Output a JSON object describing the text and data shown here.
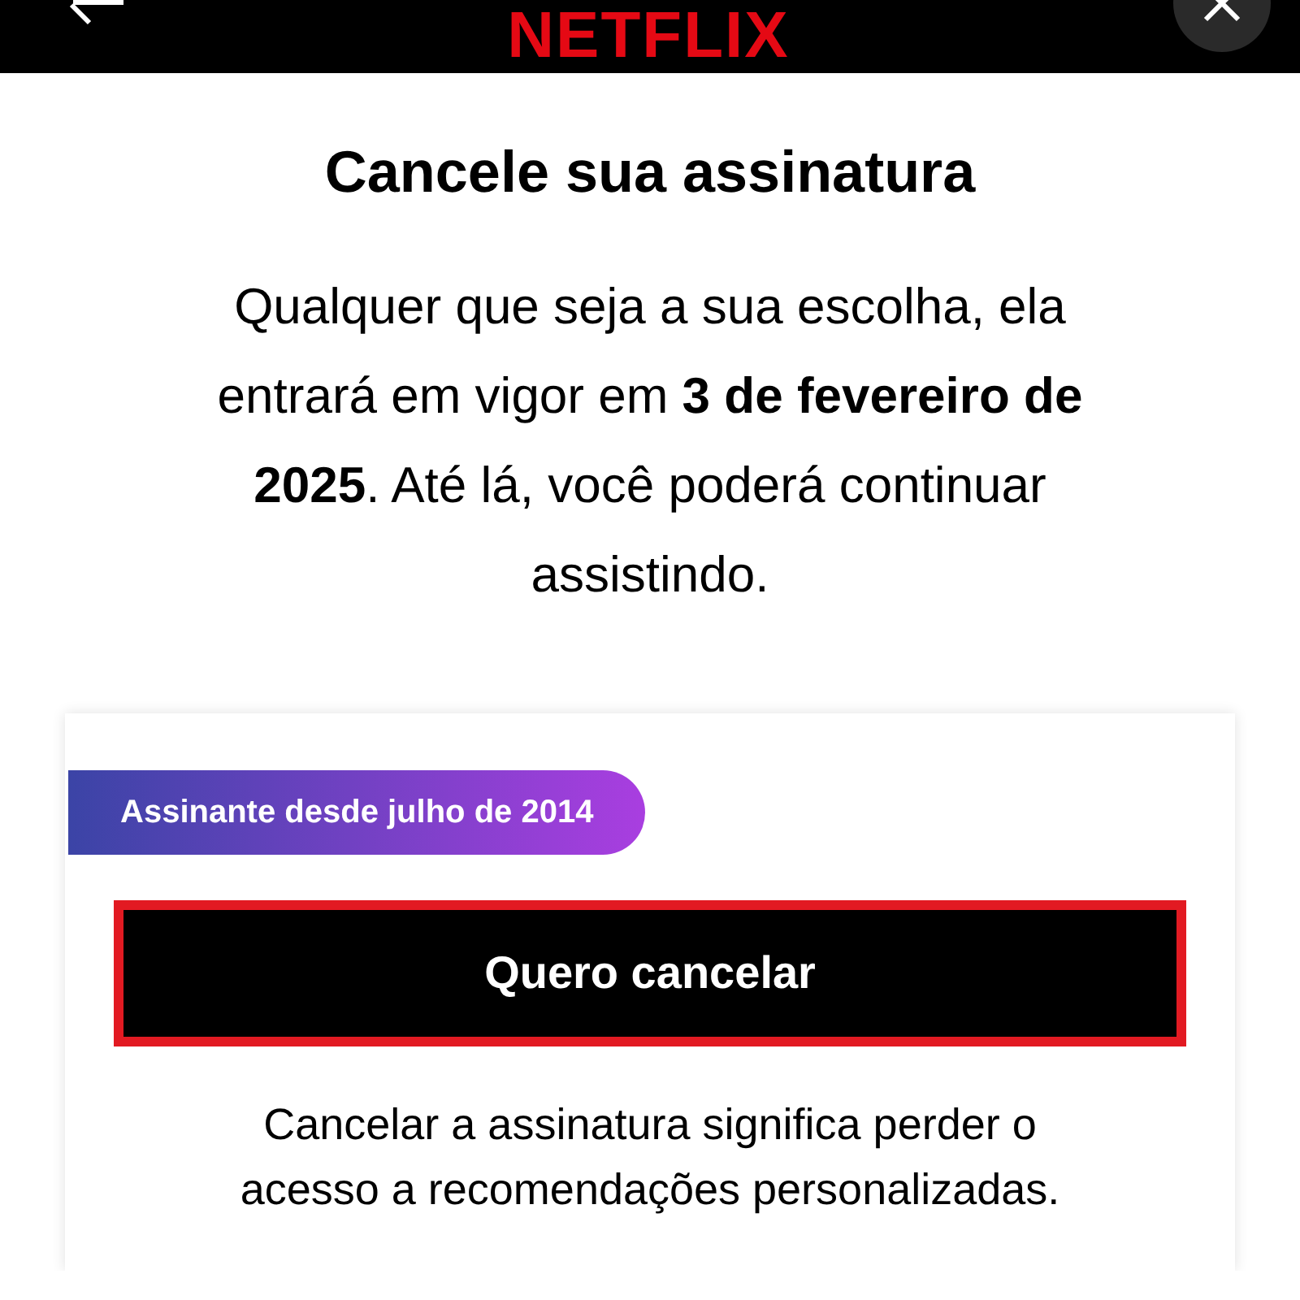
{
  "header": {
    "logo": "NETFLIX"
  },
  "title": "Cancele sua assinatura",
  "intro": "Qualquer que seja a sua escolha, ela entrará em vigor em **3 de fevereiro de 2025**. Até lá, você poderá continuar assistindo.",
  "card": {
    "badge": "Assinante desde julho de 2014",
    "button": "Quero cancelar",
    "note": "Cancelar a assinatura significa perder o acesso a recomendações personalizadas."
  }
}
